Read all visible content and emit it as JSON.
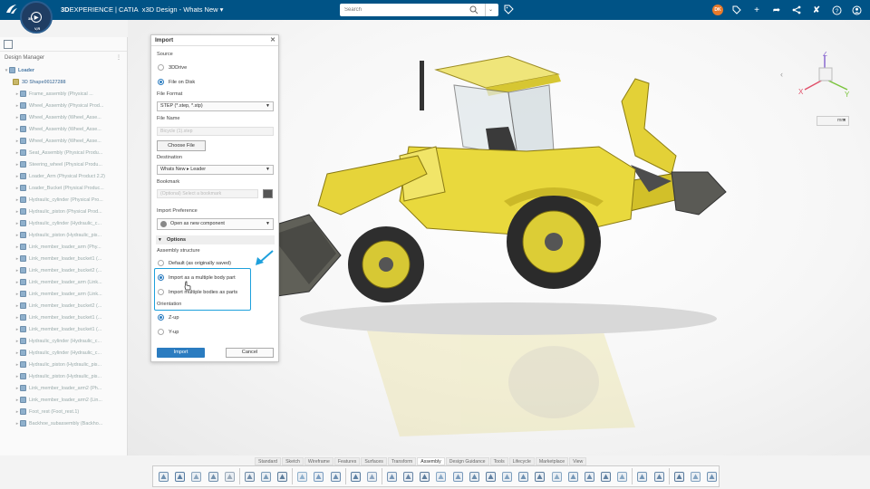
{
  "header": {
    "brand_prefix": "3D",
    "brand_main": "EXPERIENCE | CATIA",
    "app_title": "x3D Design - Whats New",
    "search_placeholder": "Search",
    "compass_letters": {
      "top": "3D",
      "left": "",
      "right": "",
      "bottom": "V,R"
    },
    "user_initials": "DK",
    "accent": "#005386"
  },
  "tree": {
    "panel_title": "Design Manager",
    "root": "Loader",
    "top_item": "3D Shape00127288",
    "items": [
      "Frame_assembly (Physical ...",
      "Wheel_Assembly (Physical Prod...",
      "Wheel_Assembly (Wheel_Asse...",
      "Wheel_Assembly (Wheel_Asse...",
      "Wheel_Assembly (Wheel_Asse...",
      "Seat_Assembly (Physical Produ...",
      "Steering_wheel (Physical Produ...",
      "Loader_Arm (Physical Product 2.2)",
      "Loader_Bucket (Physical Produc...",
      "Hydraulic_cylinder (Physical Pro...",
      "Hydraulic_piston (Physical Prod...",
      "Hydraulic_cylinder (Hydraulic_c...",
      "Hydraulic_piston (Hydraulic_pis...",
      "Link_member_loader_arm (Phy...",
      "Link_member_loader_bucket1 (...",
      "Link_member_loader_bucket2 (...",
      "Link_member_loader_arm (Link...",
      "Link_member_loader_arm (Link...",
      "Link_member_loader_bucket2 (...",
      "Link_member_loader_bucket1 (...",
      "Link_member_loader_bucket1 (...",
      "Hydraulic_cylinder (Hydraulic_c...",
      "Hydraulic_cylinder (Hydraulic_c...",
      "Hydraulic_piston (Hydraulic_pis...",
      "Hydraulic_piston (Hydraulic_pis...",
      "Link_member_loader_arm2 (Ph...",
      "Link_member_loader_arm2 (Lin...",
      "Foot_rest (Foot_rest.1)",
      "Backhoe_subassembly (Backho..."
    ]
  },
  "dialog": {
    "title": "Import",
    "source_label": "Source",
    "source_options": [
      "3DDrive",
      "File on Disk"
    ],
    "file_format_label": "File Format",
    "file_format_value": "STEP (*.step, *.stp)",
    "file_name_label": "File Name",
    "file_name_value": "Bicycle (1).step",
    "choose_file": "Choose File",
    "destination_label": "Destination",
    "destination_value": "Whats New ▸ Leader",
    "bookmark_label": "Bookmark",
    "bookmark_placeholder": "(Optional) Select a bookmark",
    "import_pref_label": "Import Preference",
    "import_pref_value": "Open as new component",
    "options_header": "Options",
    "assembly_label": "Assembly structure",
    "assembly_options": [
      "Default (as originally saved)",
      "Import as a multiple body part",
      "Import multiple bodies as parts"
    ],
    "orientation_label": "Orientation",
    "orientation_options": [
      "Z-up",
      "Y-up"
    ],
    "import_btn": "Import",
    "cancel_btn": "Cancel"
  },
  "viewport": {
    "unit": "mm",
    "axis_labels": {
      "x": "X",
      "y": "Y",
      "z": "Z"
    }
  },
  "action_bar": {
    "tabs": [
      "Standard",
      "Sketch",
      "Wireframe",
      "Features",
      "Surfaces",
      "Transform",
      "Assembly",
      "Design Guidance",
      "Tools",
      "Lifecycle",
      "Marketplace",
      "View"
    ],
    "active_tab": "Assembly"
  }
}
